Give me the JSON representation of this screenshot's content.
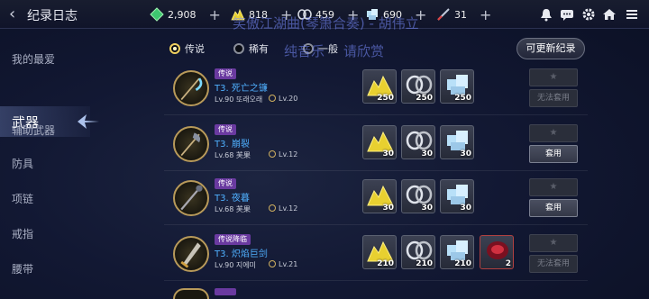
{
  "header": {
    "title": "纪录日志",
    "currencies": [
      {
        "icon": "green-crystal-icon",
        "value": "2,908"
      },
      {
        "icon": "gold-pile-icon",
        "value": "818"
      },
      {
        "icon": "silver-chain-icon",
        "value": "459"
      },
      {
        "icon": "ice-crystal-icon",
        "value": "690"
      },
      {
        "icon": "blade-shard-icon",
        "value": "31"
      }
    ],
    "right_icons": [
      "bell-icon",
      "chat-icon",
      "gear-icon",
      "home-icon",
      "menu-icon"
    ]
  },
  "sidebar": {
    "items": [
      "我的最爱",
      "武器",
      "辅助武器",
      "防具",
      "项链",
      "戒指",
      "腰带"
    ],
    "active": "武器"
  },
  "filters": [
    {
      "label": "传说",
      "selected": true
    },
    {
      "label": "稀有",
      "selected": false
    },
    {
      "label": "一般",
      "selected": false
    }
  ],
  "overlay_text": {
    "line1": "笑傲江湖曲(琴箫合奏) - 胡伟立",
    "line2a": "纯音乐",
    "line2b": "请欣赏"
  },
  "update_button": "可更新纪录",
  "rows": [
    {
      "badge": "传说",
      "name": "T3. 死亡之镰",
      "level": "Lv.90 또래오래",
      "req": "Lv.20",
      "materials": [
        {
          "icon": "gold-pile-icon",
          "qty": "250"
        },
        {
          "icon": "silver-chain-icon",
          "qty": "250"
        },
        {
          "icon": "ice-crystal-icon",
          "qty": "250"
        }
      ],
      "star": "★",
      "action": "无法套用",
      "action_enabled": false
    },
    {
      "badge": "传说",
      "name": "T3. 崩裂",
      "level": "Lv.68 芙果",
      "req": "Lv.12",
      "materials": [
        {
          "icon": "gold-pile-icon",
          "qty": "30"
        },
        {
          "icon": "silver-chain-icon",
          "qty": "30"
        },
        {
          "icon": "ice-crystal-icon",
          "qty": "30"
        }
      ],
      "star": "★",
      "action": "套用",
      "action_enabled": true
    },
    {
      "badge": "传说",
      "name": "T3. 夜暮",
      "level": "Lv.68 芙果",
      "req": "Lv.12",
      "materials": [
        {
          "icon": "gold-pile-icon",
          "qty": "30"
        },
        {
          "icon": "silver-chain-icon",
          "qty": "30"
        },
        {
          "icon": "ice-crystal-icon",
          "qty": "30"
        }
      ],
      "star": "★",
      "action": "套用",
      "action_enabled": true
    },
    {
      "badge": "传说降临",
      "name": "T3. 炽焰巨剑",
      "level": "Lv.90 지에미",
      "req": "Lv.21",
      "materials": [
        {
          "icon": "gold-pile-icon",
          "qty": "210"
        },
        {
          "icon": "silver-chain-icon",
          "qty": "210"
        },
        {
          "icon": "ice-crystal-icon",
          "qty": "210"
        },
        {
          "icon": "red-gem-icon",
          "qty": "2"
        }
      ],
      "star": "★",
      "action": "无法套用",
      "action_enabled": false
    }
  ]
}
